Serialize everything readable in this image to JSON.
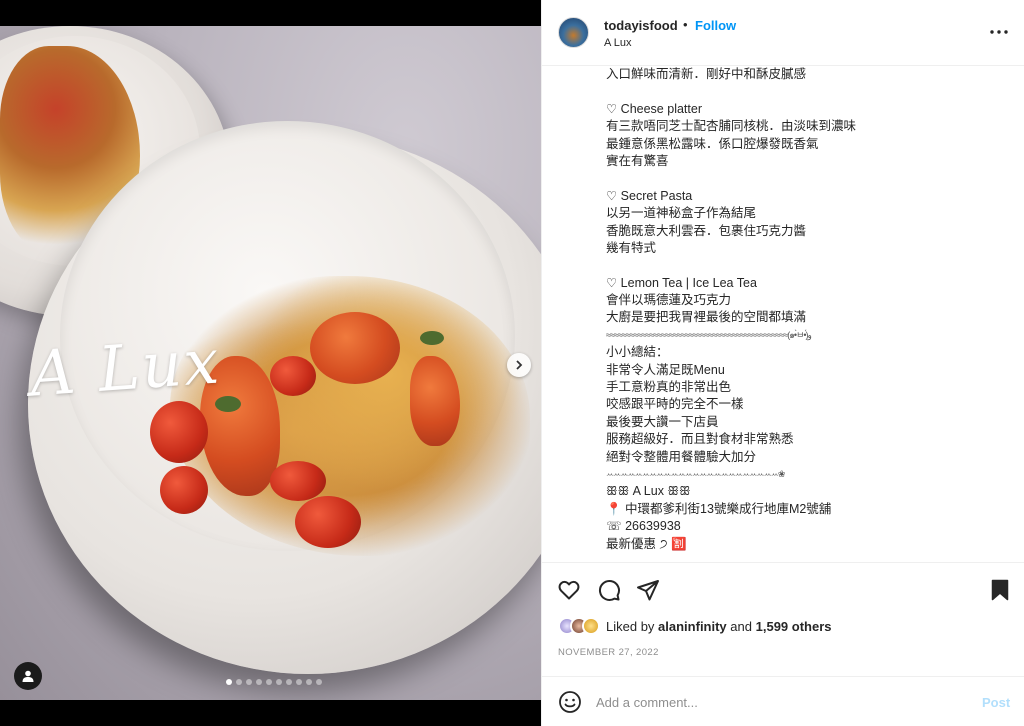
{
  "post": {
    "username": "todayisfood",
    "separator": "•",
    "follow_label": "Follow",
    "location": "A Lux",
    "watermark_text": "A Lux",
    "carousel": {
      "slide_count": 10,
      "active_index": 0
    },
    "caption_lines": [
      "入口鮮味而清新．剛好中和酥皮膩感",
      "",
      "♡ Cheese platter",
      "有三款唔同芝士配杏脯同核桃．由淡味到濃味",
      "最鍾意係黑松露味．係口腔爆發既香氣",
      "實在有驚喜",
      "",
      "♡ Secret Pasta",
      "以另一道神秘盒子作為結尾",
      "香脆既意大利雲吞．包裹住巧克力醬",
      "幾有特式",
      "",
      "♡ Lemon Tea | Ice Lea Tea",
      "會伴以瑪德蓮及巧克力",
      "大廚是要把我胃裡最後的空間都填滿",
      "≈≈≈≈≈≈≈≈≈≈≈≈≈≈≈≈≈≈≈≈≈≈≈≈≈≈≈≈≈≈≈≈≈≈≈≈≈≈≈≈≈≈≈≈≈≈(๑•̀ㅂ•́)و",
      "小小總結：",
      "非常令人滿足既Menu",
      "手工意粉真的非常出色",
      "咬感跟平時的完全不一樣",
      "最後要大讚一下店員",
      "服務超級好．而且對食材非常熟悉",
      "絕對令整體用餐體驗大加分",
      "ꕀꕀꕀꕀꕀꕀꕀꕀꕀꕀꕀꕀꕀꕀꕀꕀꕀꕀꕀꕀꕀꕀꕀꕀ❀",
      "ꕥꕥ A Lux ꕥꕥ",
      "📍 中環都爹利街13號樂成行地庫M2號舖",
      "☏ 26639938",
      "最新優惠 ੭ 🈹"
    ],
    "likes": {
      "prefix": "Liked by",
      "user": "alaninfinity",
      "joiner": "and",
      "others": "1,599 others"
    },
    "date": "NOVEMBER 27, 2022",
    "comment": {
      "placeholder": "Add a comment...",
      "post_label": "Post"
    }
  },
  "icons": {
    "more": "more-horizontal-icon",
    "like": "heart-icon",
    "comment": "comment-icon",
    "share": "share-icon",
    "save": "bookmark-icon",
    "emoji": "smiley-icon",
    "next": "chevron-right-icon",
    "user_tag": "user-icon"
  },
  "colors": {
    "accent": "#0095f6",
    "post_disabled": "#b2dffc",
    "text": "#262626",
    "muted": "#8e8e8e"
  }
}
